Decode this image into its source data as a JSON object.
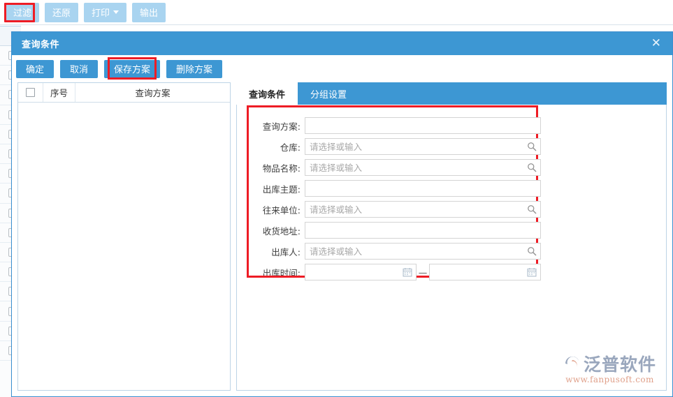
{
  "colors": {
    "accent": "#3d97d3",
    "toolbar_button": "#a9d4f0",
    "annotation": "#ee1c25",
    "panel_border": "#bdd4e6"
  },
  "toolbar": {
    "buttons": [
      {
        "label": "过滤",
        "highlighted": true,
        "has_caret": false
      },
      {
        "label": "还原",
        "highlighted": false,
        "has_caret": false
      },
      {
        "label": "打印",
        "highlighted": false,
        "has_caret": true
      },
      {
        "label": "输出",
        "highlighted": false,
        "has_caret": false
      }
    ]
  },
  "dialog": {
    "title": "查询条件",
    "close_icon": "close-icon",
    "close_glyph": "✕",
    "actions": [
      {
        "label": "确定",
        "highlighted": false
      },
      {
        "label": "取消",
        "highlighted": false
      },
      {
        "label": "保存方案",
        "highlighted": true
      },
      {
        "label": "删除方案",
        "highlighted": false
      }
    ],
    "scheme_table": {
      "columns": [
        "",
        "序号",
        "查询方案"
      ],
      "select_all_checkbox": false,
      "rows": []
    },
    "tabs": [
      {
        "label": "查询条件",
        "active": true
      },
      {
        "label": "分组设置",
        "active": false
      }
    ],
    "form": {
      "fields": [
        {
          "label": "查询方案:",
          "value": "",
          "placeholder": "",
          "icon": "none",
          "type": "text"
        },
        {
          "label": "仓库:",
          "value": "",
          "placeholder": "请选择或输入",
          "icon": "search-icon",
          "type": "lookup"
        },
        {
          "label": "物品名称:",
          "value": "",
          "placeholder": "请选择或输入",
          "icon": "search-icon",
          "type": "lookup"
        },
        {
          "label": "出库主题:",
          "value": "",
          "placeholder": "",
          "icon": "none",
          "type": "text"
        },
        {
          "label": "往来单位:",
          "value": "",
          "placeholder": "请选择或输入",
          "icon": "search-icon",
          "type": "lookup"
        },
        {
          "label": "收货地址:",
          "value": "",
          "placeholder": "",
          "icon": "none",
          "type": "text"
        },
        {
          "label": "出库人:",
          "value": "",
          "placeholder": "请选择或输入",
          "icon": "search-icon",
          "type": "lookup"
        },
        {
          "label": "出库时间:",
          "type": "date-range",
          "icon": "calendar-icon",
          "separator": "—",
          "start": {
            "value": "",
            "placeholder": ""
          },
          "end": {
            "value": "",
            "placeholder": ""
          }
        }
      ]
    }
  },
  "watermark": {
    "brand": "泛普软件",
    "url": "www.fanpusoft.com"
  }
}
